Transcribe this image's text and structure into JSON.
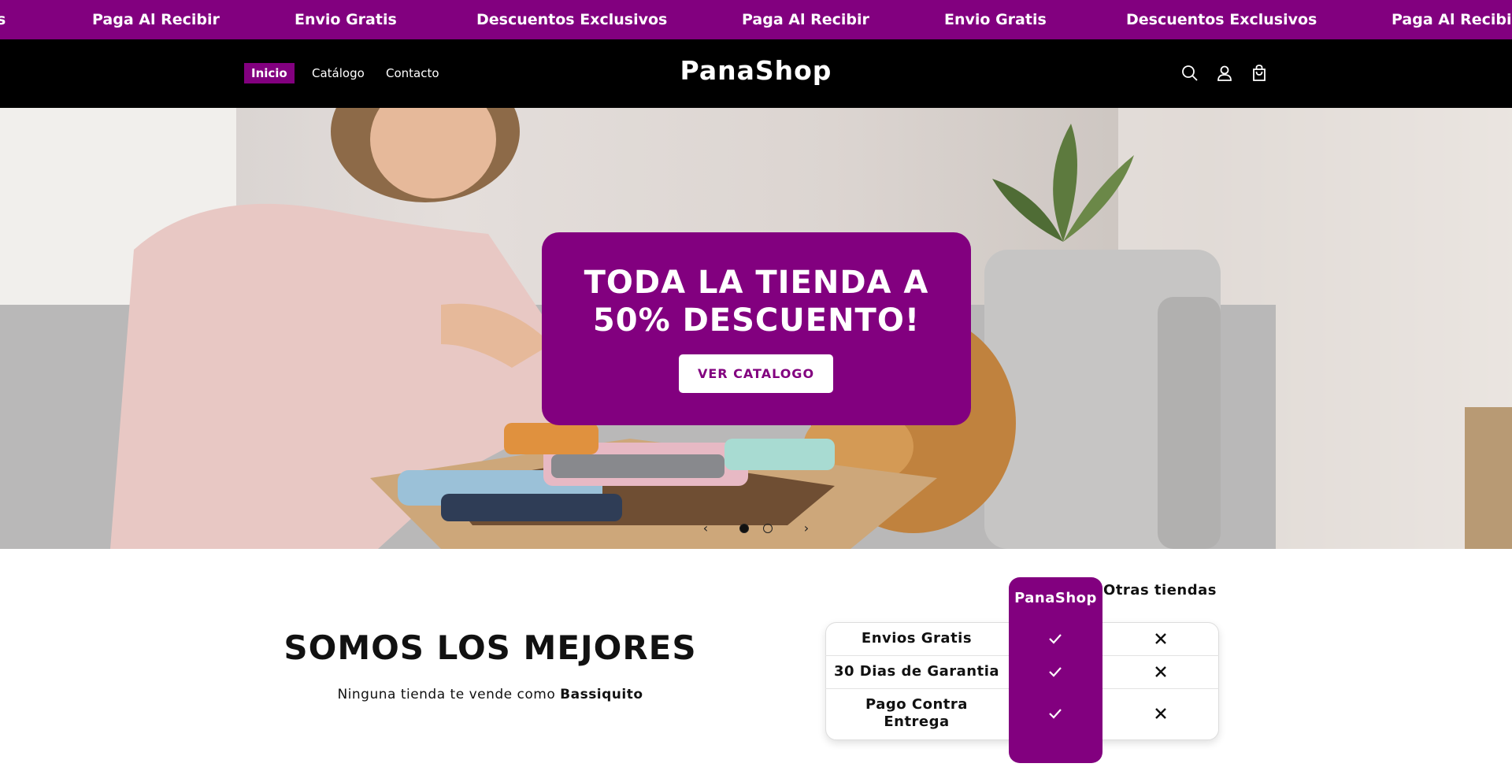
{
  "announcement": {
    "items": [
      "s",
      "Paga Al Recibir",
      "Envio Gratis",
      "Descuentos Exclusivos",
      "Paga Al Recibir",
      "Envio Gratis",
      "Descuentos Exclusivos",
      "Paga Al Recibir"
    ]
  },
  "header": {
    "nav": [
      "Inicio",
      "Catálogo",
      "Contacto"
    ],
    "active_nav": "Inicio",
    "logo": "PanaShop",
    "icons": [
      "search-icon",
      "account-icon",
      "cart-icon"
    ]
  },
  "hero": {
    "title": "TODA LA TIENDA A 50% DESCUENTO!",
    "button": "VER CATALOGO",
    "slides": 2,
    "active_slide": 1
  },
  "section": {
    "heading": "SOMOS LOS MEJORES",
    "subtitle_prefix": "Ninguna tienda te vende como ",
    "subtitle_brand": "Bassiquito"
  },
  "comparison": {
    "columns": [
      "PanaShop",
      "Otras tiendas"
    ],
    "rows": [
      {
        "label": "Envios Gratis",
        "panashop": "check-icon",
        "otras": "x-icon"
      },
      {
        "label": "30 Dias de Garantia",
        "panashop": "check-icon",
        "otras": "x-icon"
      },
      {
        "label": "Pago Contra Entrega",
        "panashop": "check-icon",
        "otras": "x-icon"
      }
    ]
  },
  "colors": {
    "brand_purple": "#82007f",
    "header_bg": "#000000",
    "text_dark": "#111111"
  }
}
